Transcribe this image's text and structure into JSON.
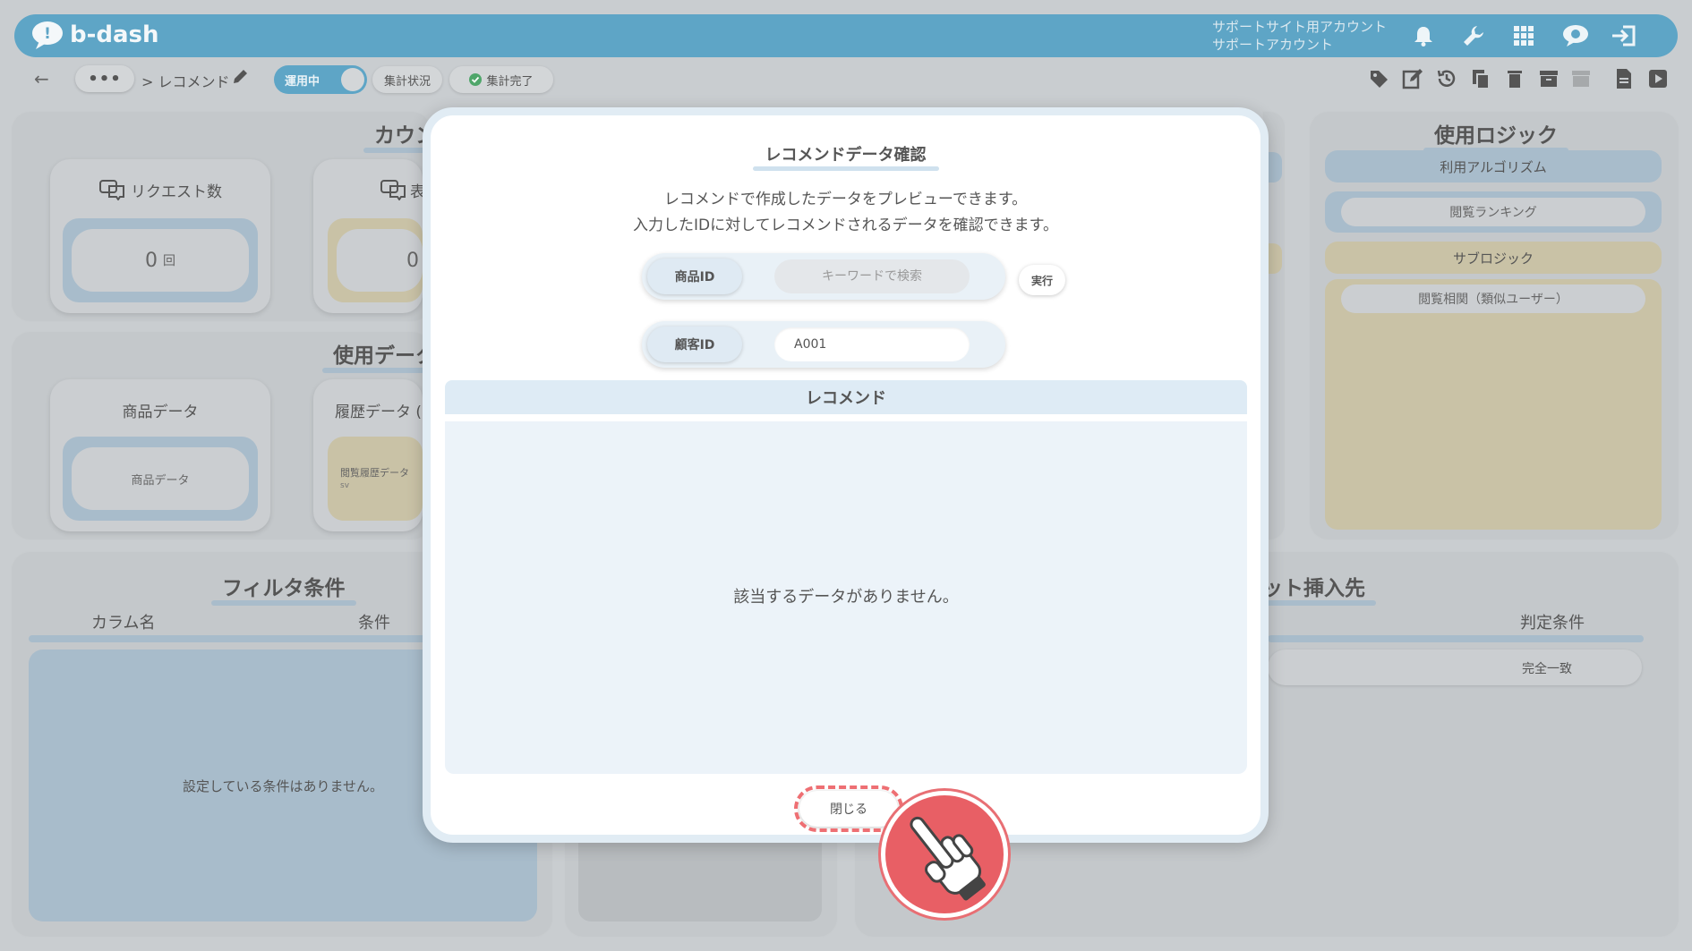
{
  "header": {
    "logo_text": "b-dash",
    "account_line1": "サポートサイト用アカウント",
    "account_line2": "サポートアカウント",
    "brand_color": "#5ea5c6"
  },
  "subbar": {
    "breadcrumb": "> レコメンド",
    "toggle_label": "運用中",
    "tag_status": "集計状況",
    "tag_done": "集計完了"
  },
  "background": {
    "count_title": "カウン",
    "request_label": "リクエスト数",
    "request_value": "0",
    "request_unit": "回",
    "display_label_partial": "表",
    "display_value_partial": "0",
    "usage_data_title": "使用データ",
    "product_data_label": "商品データ",
    "product_data_item": "商品データ",
    "history_data_label": "履歴データ (",
    "history_item_title": "閲覧履歴データ",
    "history_item_sub": "sv",
    "logic_title": "使用ロジック",
    "algo_label": "利用アルゴリズム",
    "algo_value": "閲覧ランキング",
    "sublogic_label": "サブロジック",
    "sublogic_value": "閲覧相関（類似ユーザー）",
    "filter_title": "フィルタ条件",
    "filter_col_name": "カラム名",
    "filter_col_cond": "条件",
    "filter_empty": "設定している条件はありません。",
    "insert_title": "ット挿入先",
    "judge_label": "判定条件",
    "judge_value": "完全一致"
  },
  "modal": {
    "title": "レコメンドデータ確認",
    "desc_line1": "レコメンドで作成したデータをプレビューできます。",
    "desc_line2": "入力したIDに対してレコメンドされるデータを確認できます。",
    "product_id_label": "商品ID",
    "product_id_placeholder": "キーワードで検索",
    "exec_label": "実行",
    "customer_id_label": "顧客ID",
    "customer_id_value": "A001",
    "rec_header": "レコメンド",
    "rec_empty": "該当するデータがありません。",
    "close_label": "閉じる"
  }
}
